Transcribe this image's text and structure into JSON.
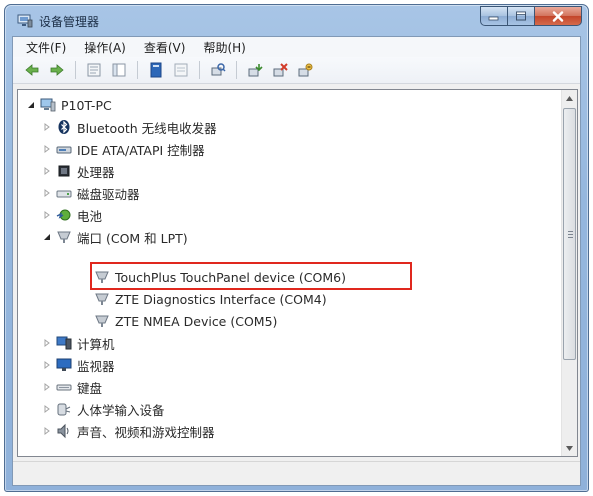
{
  "window": {
    "title": "设备管理器",
    "icon": "device-manager-icon",
    "caption_icons": [
      "minimize-icon",
      "maximize-icon",
      "close-icon"
    ]
  },
  "menu": {
    "file": "文件(F)",
    "action": "操作(A)",
    "view": "查看(V)",
    "help": "帮助(H)"
  },
  "toolbar": {
    "icons": [
      "back-icon",
      "forward-icon",
      "properties-list-icon",
      "show-hide-tree-icon",
      "help-icon",
      "show-console-icon",
      "scan-hardware-icon",
      "update-driver-icon",
      "uninstall-icon",
      "disable-icon"
    ]
  },
  "tree": {
    "root": "P10T-PC",
    "bluetooth": "Bluetooth 无线电收发器",
    "ide": "IDE ATA/ATAPI 控制器",
    "processor": "处理器",
    "disk": "磁盘驱动器",
    "battery": "电池",
    "ports": "端口 (COM 和 LPT)",
    "port_touch": "TouchPlus TouchPanel device (COM6)",
    "port_zte_diag": "ZTE Diagnostics Interface (COM4)",
    "port_zte_nmea": "ZTE NMEA Device (COM5)",
    "computer": "计算机",
    "monitor": "监视器",
    "keyboard": "键盘",
    "hid": "人体学输入设备",
    "sound": "声音、视频和游戏控制器"
  },
  "annotation": {
    "highlight_color": "#e0281e",
    "highlighted_item": "TouchPlus TouchPanel device (COM6)"
  },
  "colors": {
    "title_bar": "#a8c5e6",
    "close_button": "#c3452a",
    "tree_background": "#ffffff"
  }
}
